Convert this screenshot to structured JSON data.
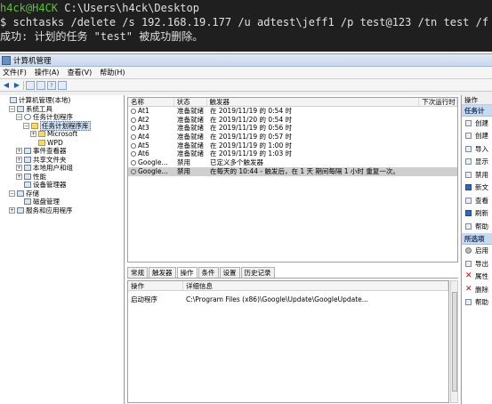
{
  "terminal": {
    "prompt_user": "h4ck@H4CK",
    "prompt_path": " C:\\Users\\h4ck\\Desktop",
    "dollar": "$",
    "command": " schtasks /delete /s 192.168.19.177 /u adtest\\jeff1 /p test@123 /tn test /f",
    "output": "成功: 计划的任务 \"test\" 被成功删除。"
  },
  "window": {
    "title": "计算机管理",
    "menu": [
      "文件(F)",
      "操作(A)",
      "查看(V)",
      "帮助(H)"
    ]
  },
  "tree": [
    {
      "label": "计算机管理(本地)",
      "indent": 0,
      "exp": "",
      "icon": "computer-icon"
    },
    {
      "label": "系统工具",
      "indent": 1,
      "exp": "−",
      "icon": "tools-icon"
    },
    {
      "label": "任务计划程序",
      "indent": 2,
      "exp": "−",
      "icon": "clock-icon"
    },
    {
      "label": "任务计划程序库",
      "indent": 3,
      "exp": "−",
      "icon": "folder-icon",
      "selected": true
    },
    {
      "label": "Microsoft",
      "indent": 4,
      "exp": "+",
      "icon": "folder-icon"
    },
    {
      "label": "WPD",
      "indent": 4,
      "exp": "",
      "icon": "folder-icon"
    },
    {
      "label": "事件查看器",
      "indent": 2,
      "exp": "+",
      "icon": "event-viewer-icon"
    },
    {
      "label": "共享文件夹",
      "indent": 2,
      "exp": "+",
      "icon": "shared-folder-icon"
    },
    {
      "label": "本地用户和组",
      "indent": 2,
      "exp": "+",
      "icon": "users-icon"
    },
    {
      "label": "性能",
      "indent": 2,
      "exp": "+",
      "icon": "performance-icon"
    },
    {
      "label": "设备管理器",
      "indent": 2,
      "exp": "",
      "icon": "device-manager-icon"
    },
    {
      "label": "存储",
      "indent": 1,
      "exp": "−",
      "icon": "storage-icon"
    },
    {
      "label": "磁盘管理",
      "indent": 2,
      "exp": "",
      "icon": "disk-icon"
    },
    {
      "label": "服务和应用程序",
      "indent": 1,
      "exp": "+",
      "icon": "services-icon"
    }
  ],
  "tasks": {
    "columns": [
      "名称",
      "状态",
      "触发器",
      "下次运行时"
    ],
    "rows": [
      {
        "name": "At1",
        "status": "准备就绪",
        "trigger": "在 2019/11/19 的 0:54 时"
      },
      {
        "name": "At2",
        "status": "准备就绪",
        "trigger": "在 2019/11/20 的 0:54 时"
      },
      {
        "name": "At3",
        "status": "准备就绪",
        "trigger": "在 2019/11/19 的 0:56 时"
      },
      {
        "name": "At4",
        "status": "准备就绪",
        "trigger": "在 2019/11/19 的 0:57 时"
      },
      {
        "name": "At5",
        "status": "准备就绪",
        "trigger": "在 2019/11/19 的 1:00 时"
      },
      {
        "name": "At6",
        "status": "准备就绪",
        "trigger": "在 2019/11/19 的 1:03 时"
      },
      {
        "name": "Google...",
        "status": "禁用",
        "trigger": "已定义多个触发器"
      },
      {
        "name": "Google...",
        "status": "禁用",
        "trigger": "在每天的 10:44 - 触发后，在 1 天 期间每隔 1 小时 重复一次。",
        "selected": true
      }
    ]
  },
  "detail_tabs": [
    "常规",
    "触发器",
    "操作",
    "条件",
    "设置",
    "历史记录"
  ],
  "detail": {
    "columns": [
      "操作",
      "详细信息"
    ],
    "row": {
      "op": "启动程序",
      "info": "C:\\Program Files (x86)\\Google\\Update\\GoogleUpdate..."
    }
  },
  "actions": {
    "header": "操作",
    "section1": "任务计",
    "items1": [
      {
        "label": "创建",
        "icon": "create-basic-task-icon"
      },
      {
        "label": "创建",
        "icon": "create-task-icon"
      },
      {
        "label": "导入",
        "icon": "import-icon"
      },
      {
        "label": "显示",
        "icon": "display-running-icon"
      },
      {
        "label": "禁用",
        "icon": "disable-history-icon"
      },
      {
        "label": "新文",
        "icon": "new-folder-icon"
      },
      {
        "label": "查看",
        "icon": "view-icon"
      },
      {
        "label": "刷新",
        "icon": "refresh-icon"
      },
      {
        "label": "帮助",
        "icon": "help-icon"
      }
    ],
    "section2": "所选项",
    "items2": [
      {
        "label": "启用",
        "icon": "enable-icon"
      },
      {
        "label": "导出",
        "icon": "export-icon"
      },
      {
        "label": "属性",
        "icon": "properties-icon"
      },
      {
        "label": "删除",
        "icon": "delete-icon"
      },
      {
        "label": "帮助",
        "icon": "help-icon"
      }
    ]
  }
}
